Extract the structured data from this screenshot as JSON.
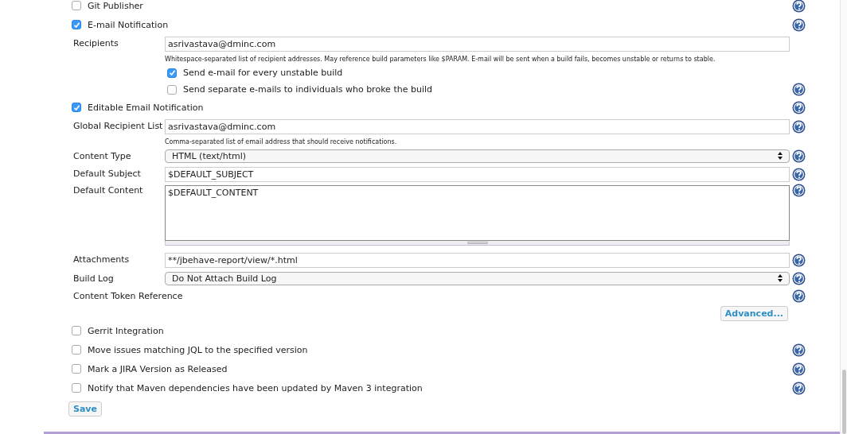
{
  "rows": [
    {
      "kind": "check",
      "label": "Git Publisher",
      "checked": false,
      "help": true
    },
    {
      "kind": "check",
      "label": "E-mail Notification",
      "checked": true,
      "help": true
    },
    {
      "kind": "field",
      "label": "Recipients",
      "value": "asrivastava@dminc.com",
      "help": false
    },
    {
      "kind": "note",
      "text": "Whitespace-separated list of recipient addresses. May reference build parameters like $PARAM. E-mail will be sent when a build fails, becomes unstable or returns to stable.",
      "help": false
    },
    {
      "kind": "subcheck",
      "label": "Send e-mail for every unstable build",
      "checked": true,
      "help": false
    },
    {
      "kind": "subcheck",
      "label": "Send separate e-mails to individuals who broke the build",
      "checked": false,
      "help": true
    },
    {
      "kind": "check",
      "label": "Editable Email Notification",
      "checked": true,
      "help": true
    },
    {
      "kind": "field",
      "label": "Global Recipient List",
      "value": "asrivastava@dminc.com",
      "help": true
    },
    {
      "kind": "note",
      "text": "Comma-separated list of email address that should receive notifications.",
      "help": false
    },
    {
      "kind": "select",
      "label": "Content Type",
      "value": "HTML (text/html)",
      "help": true
    },
    {
      "kind": "field",
      "label": "Default Subject",
      "value": "$DEFAULT_SUBJECT",
      "help": true
    },
    {
      "kind": "textarea",
      "label": "Default Content",
      "value": "$DEFAULT_CONTENT",
      "help": true
    },
    {
      "kind": "field",
      "label": "Attachments",
      "value": "**/jbehave-report/view/*.html",
      "help": true
    },
    {
      "kind": "select",
      "label": "Build Log",
      "value": "Do Not Attach Build Log",
      "help": true
    },
    {
      "kind": "label",
      "label": "Content Token Reference",
      "help": true
    },
    {
      "kind": "advanced",
      "label": "Advanced...",
      "help": false
    },
    {
      "kind": "check",
      "label": "Gerrit Integration",
      "checked": false,
      "help": false
    },
    {
      "kind": "check",
      "label": "Move issues matching JQL to the specified version",
      "checked": false,
      "help": true
    },
    {
      "kind": "check",
      "label": "Mark a JIRA Version as Released",
      "checked": false,
      "help": true
    },
    {
      "kind": "check",
      "label": "Notify that Maven dependencies have been updated by Maven 3 integration",
      "checked": false,
      "help": true
    },
    {
      "kind": "save",
      "label": "Save",
      "help": false
    }
  ]
}
